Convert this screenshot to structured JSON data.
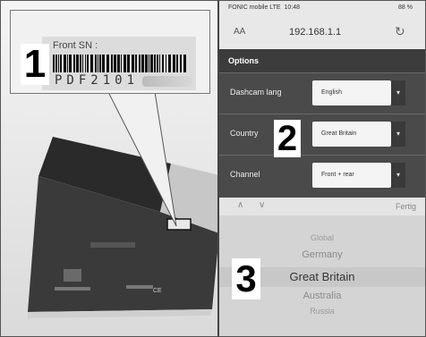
{
  "left_panel": {
    "callout_number": "1",
    "label_title": "Front SN :",
    "serial_visible": "PDF2101"
  },
  "right_panel": {
    "status_carrier": "FONIC mobile LTE",
    "status_time": "10:48",
    "status_battery": "88 %",
    "text_size_label": "AA",
    "url": "192.168.1.1",
    "reload_icon": "↻",
    "options_header": "Options",
    "rows": [
      {
        "label": "Dashcam lang",
        "value": "English"
      },
      {
        "label": "Country",
        "value": "Great Britain"
      },
      {
        "label": "Channel",
        "value": "Front + rear"
      }
    ],
    "callout_number_2": "2",
    "prev_icon": "∧",
    "next_icon": "∨",
    "done_label": "Fertig",
    "picker_items": [
      "Global",
      "Germany",
      "Great Britain",
      "Australia",
      "Russia"
    ],
    "picker_selected_index": 2,
    "callout_number_3": "3"
  },
  "colors": {
    "options_bg": "#4a4a4a",
    "picker_bg": "#d4d4d4"
  }
}
